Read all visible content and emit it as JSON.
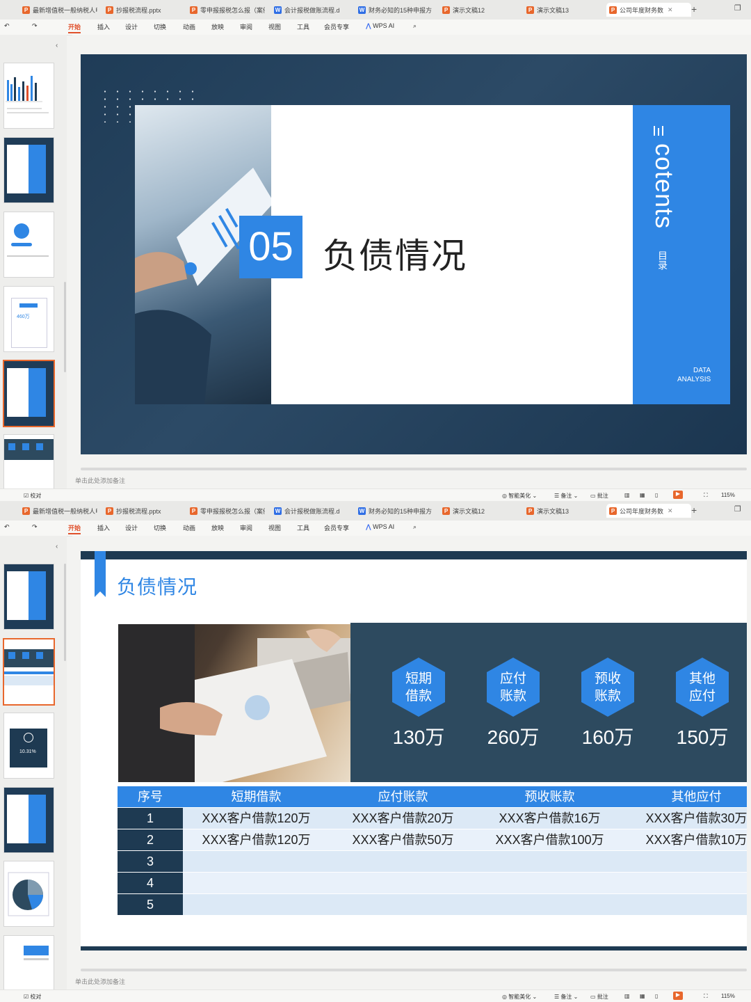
{
  "colors": {
    "accent": "#2f86e4",
    "dark_navy": "#1e3a52",
    "panel": "#2d4a5f",
    "wps_orange": "#e8672c"
  },
  "tabs": [
    {
      "label": "最新增值税一般纳税人申",
      "type": "P"
    },
    {
      "label": "抄报税流程.pptx",
      "type": "P"
    },
    {
      "label": "零申报报税怎么报（案例",
      "type": "P"
    },
    {
      "label": "会计报税做账流程.d",
      "type": "W"
    },
    {
      "label": "财务必知的15种申报方",
      "type": "W"
    },
    {
      "label": "演示文稿12",
      "type": "P"
    },
    {
      "label": "演示文稿13",
      "type": "P"
    },
    {
      "label": "公司年度财务数",
      "type": "P"
    }
  ],
  "ribbon": {
    "items": [
      "开始",
      "插入",
      "设计",
      "切换",
      "动画",
      "放映",
      "审阅",
      "视图",
      "工具",
      "会员专享"
    ],
    "wps_ai": "WPS AI"
  },
  "notes_placeholder": "单击此处添加备注",
  "status": {
    "proofread": "校对",
    "beautify": "智能美化",
    "notes": "备注",
    "comments": "批注",
    "zoom": "115%"
  },
  "slide1": {
    "number": "05",
    "title": "负债情况",
    "side_en": "cotents",
    "side_cn": "目录",
    "data_analysis_1": "DATA",
    "data_analysis_2": "ANALYSIS"
  },
  "slide2": {
    "title": "负债情况",
    "stats": [
      {
        "line1": "短期",
        "line2": "借款",
        "value": "130万"
      },
      {
        "line1": "应付",
        "line2": "账款",
        "value": "260万"
      },
      {
        "line1": "预收",
        "line2": "账款",
        "value": "160万"
      },
      {
        "line1": "其他",
        "line2": "应付",
        "value": "150万"
      }
    ],
    "table": {
      "headers": [
        "序号",
        "短期借款",
        "应付账款",
        "预收账款",
        "其他应付"
      ],
      "rows": [
        [
          "1",
          "XXX客户借款120万",
          "XXX客户借款20万",
          "XXX客户借款16万",
          "XXX客户借款30万"
        ],
        [
          "2",
          "XXX客户借款120万",
          "XXX客户借款50万",
          "XXX客户借款100万",
          "XXX客户借款10万"
        ],
        [
          "3",
          "",
          "",
          "",
          ""
        ],
        [
          "4",
          "",
          "",
          "",
          ""
        ],
        [
          "5",
          "",
          "",
          "",
          ""
        ]
      ]
    }
  },
  "thumb_texts": {
    "t_460": "460万",
    "t_1031": "10.31%"
  }
}
